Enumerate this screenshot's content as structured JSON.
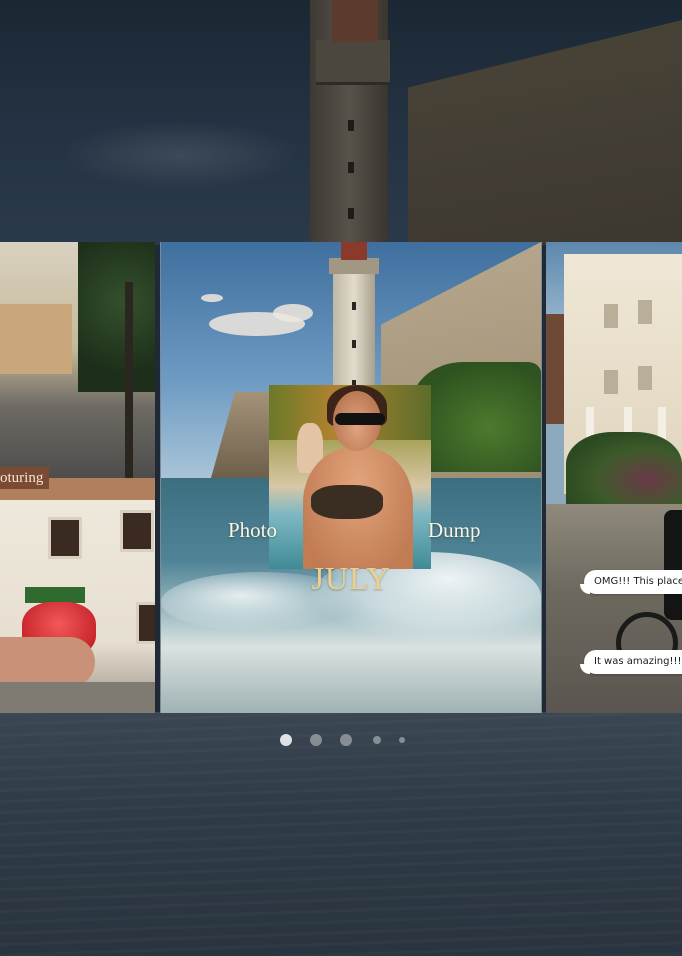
{
  "carousel": {
    "left_slide": {
      "label": "oturing"
    },
    "main_slide": {
      "word_left": "Photo",
      "word_right": "Dump",
      "month": "JULY"
    },
    "right_slide": {
      "messages": [
        "OMG!!! This place..",
        "It was amazing!!!!"
      ]
    }
  },
  "pagination": {
    "count": 5,
    "active_index": 0
  },
  "colors": {
    "label_bg": "#7a4a33",
    "month_text": "#f0cf8a",
    "bubble_bg": "#ffffff"
  }
}
